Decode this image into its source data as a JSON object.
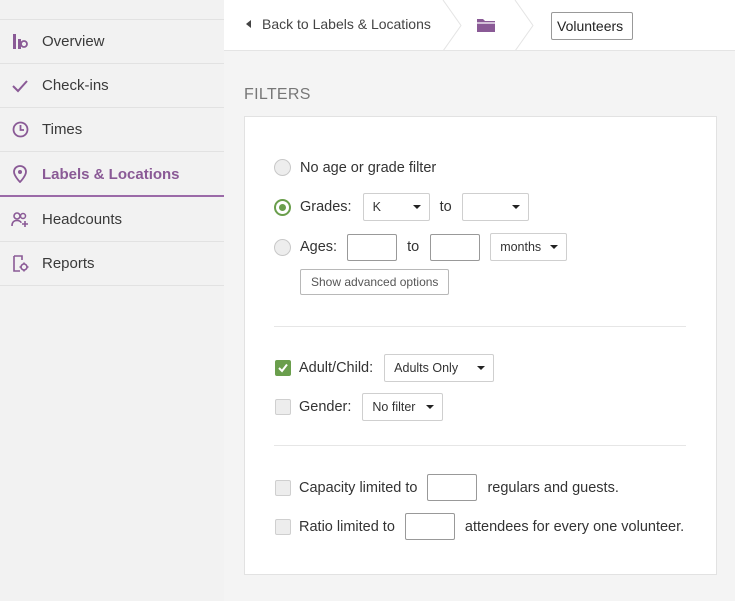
{
  "sidebar": {
    "items": [
      {
        "label": "Overview",
        "icon": "chart-icon"
      },
      {
        "label": "Check-ins",
        "icon": "checkmark-icon"
      },
      {
        "label": "Times",
        "icon": "clock-icon"
      },
      {
        "label": "Labels & Locations",
        "icon": "location-pin-icon",
        "active": true
      },
      {
        "label": "Headcounts",
        "icon": "people-add-icon"
      },
      {
        "label": "Reports",
        "icon": "report-gear-icon"
      }
    ]
  },
  "topbar": {
    "back_label": "Back to Labels & Locations",
    "title_value": "Volunteers"
  },
  "filters": {
    "heading": "FILTERS",
    "age_grade": {
      "no_filter_label": "No age or grade filter",
      "grades_label": "Grades:",
      "grades_from": "K",
      "grades_to": "",
      "to_label": "to",
      "ages_label": "Ages:",
      "ages_from": "",
      "ages_to": "",
      "ages_unit": "months",
      "selected": "grades",
      "advanced_button": "Show advanced options"
    },
    "adult_child": {
      "label": "Adult/Child:",
      "checked": true,
      "value": "Adults Only"
    },
    "gender": {
      "label": "Gender:",
      "checked": false,
      "value": "No filter"
    },
    "capacity": {
      "label": "Capacity limited to",
      "suffix": "regulars and guests.",
      "value": ""
    },
    "ratio": {
      "label": "Ratio limited to",
      "suffix": "attendees for every one volunteer.",
      "value": ""
    }
  },
  "colors": {
    "accent": "#8a5a96",
    "green": "#6a9e4c"
  }
}
